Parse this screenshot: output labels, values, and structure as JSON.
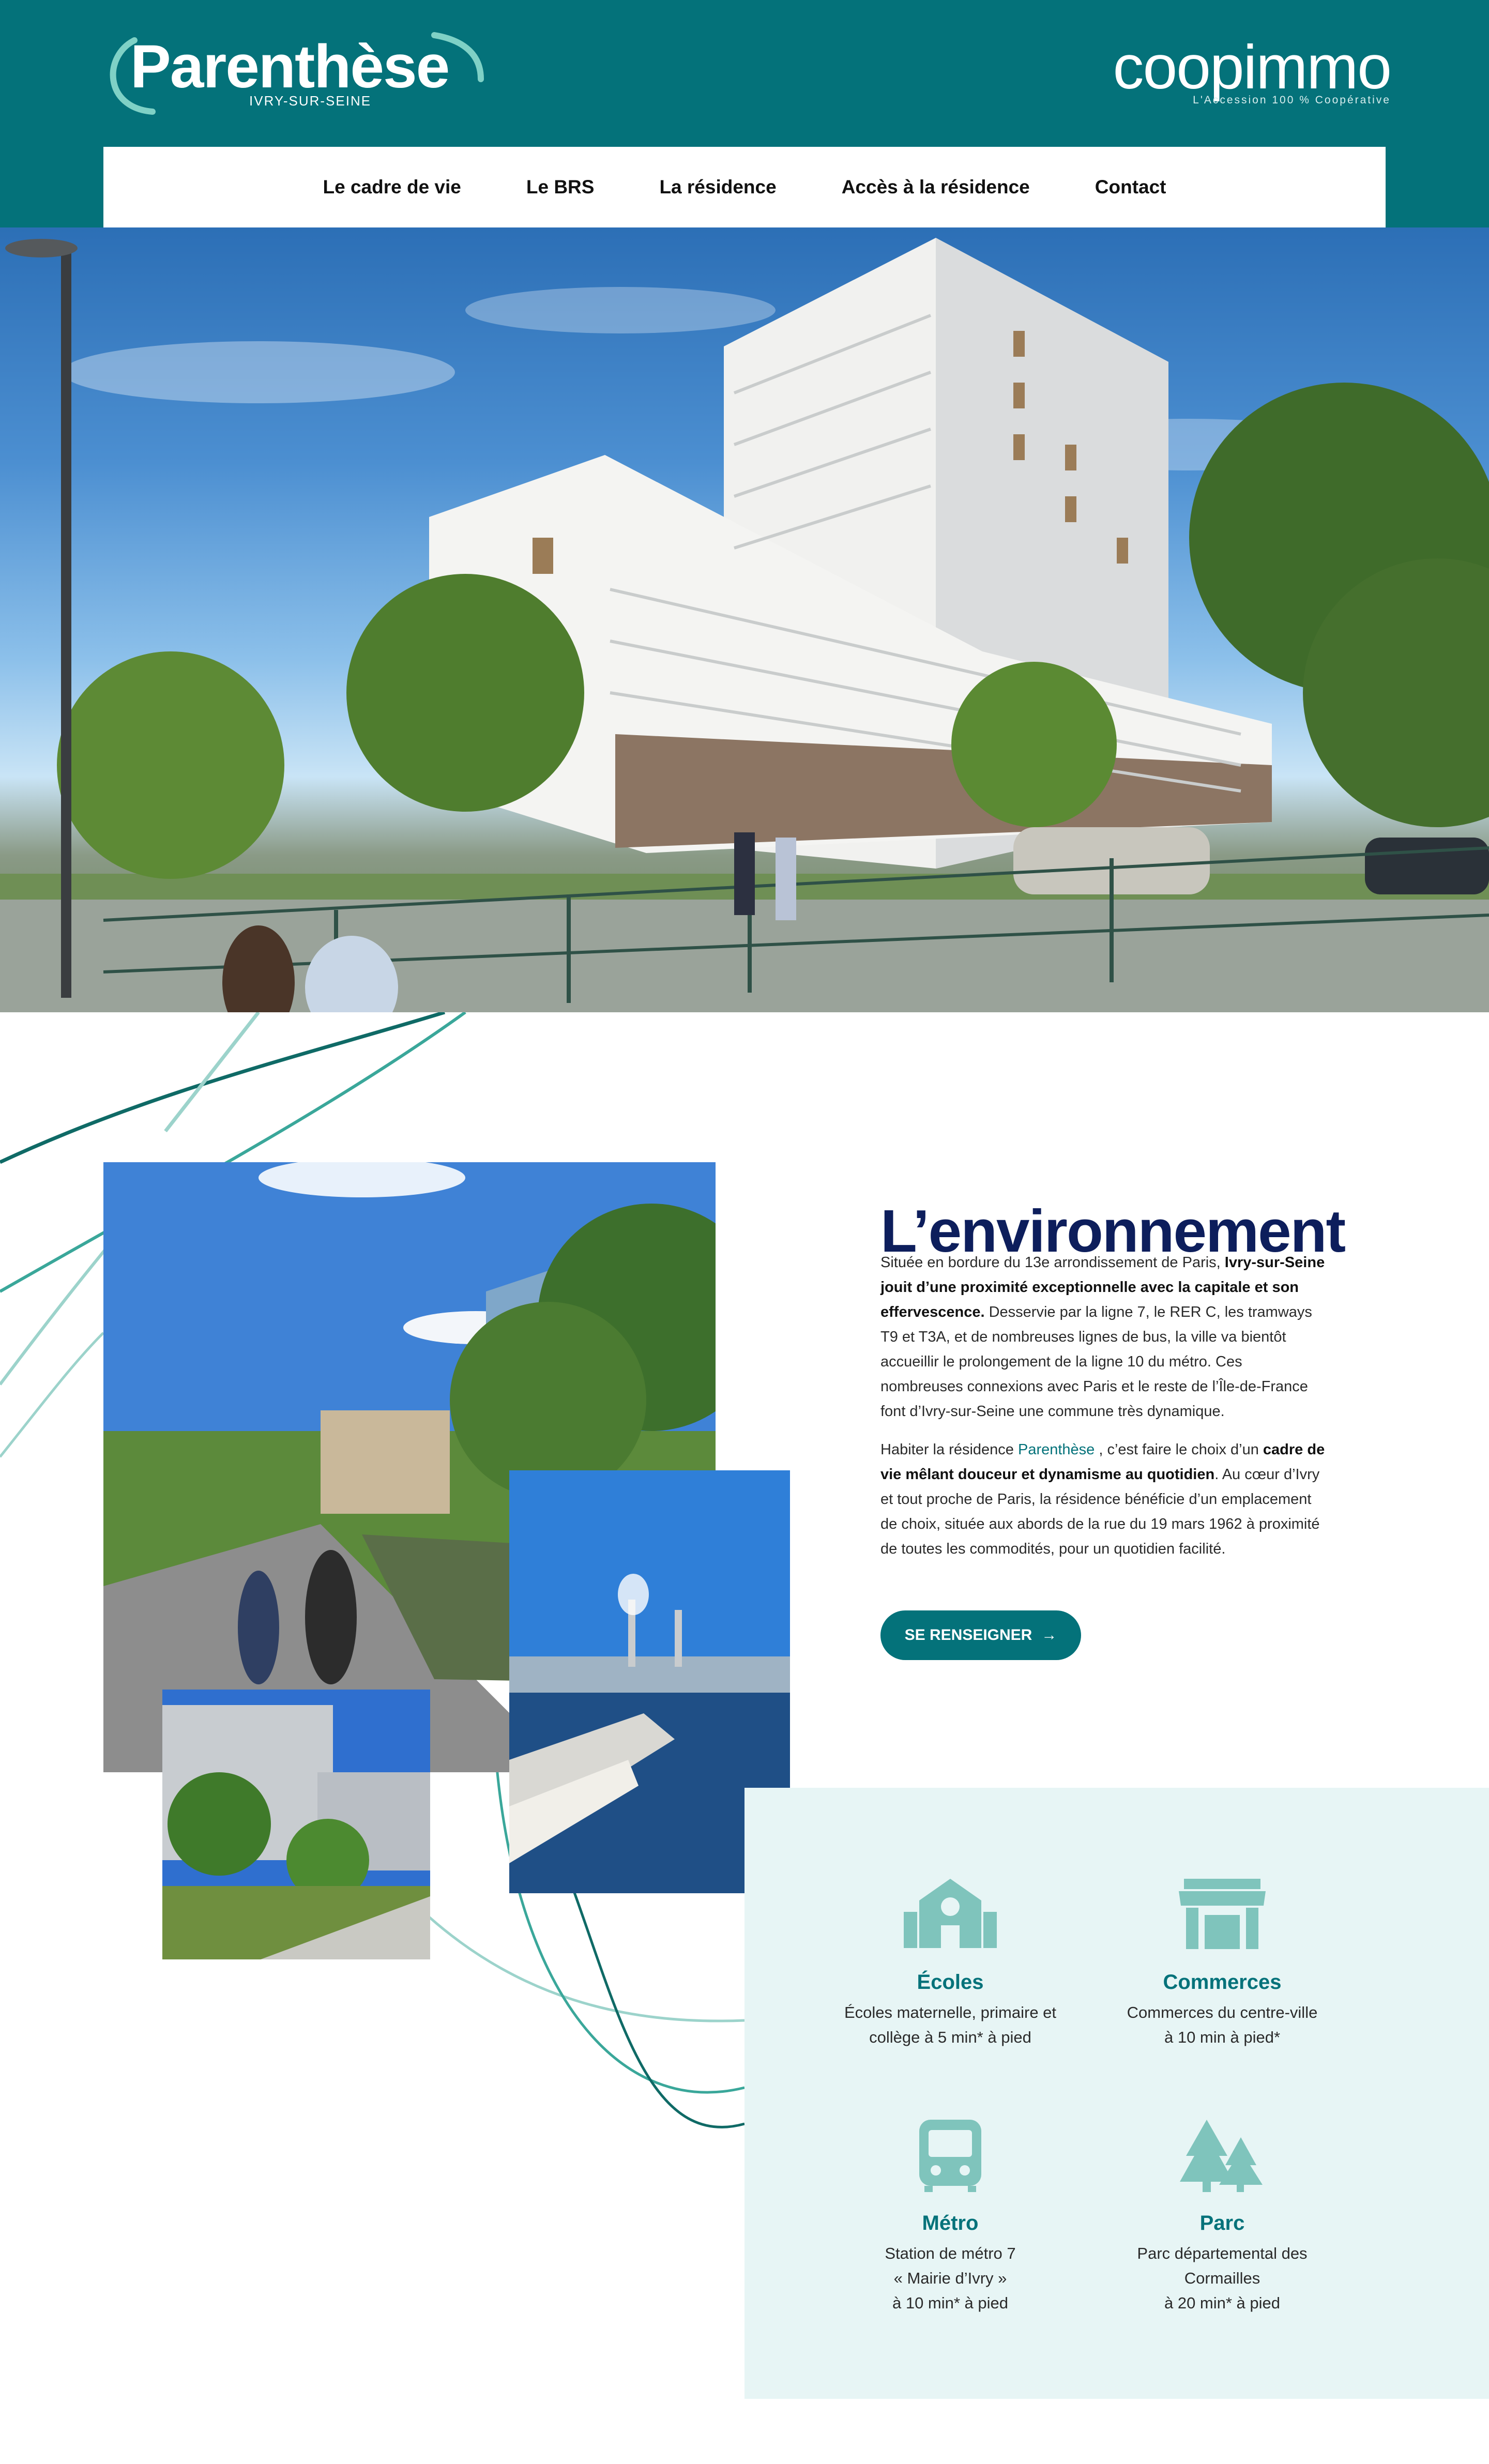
{
  "header": {
    "brand": "Parenthèse",
    "brand_sub": "IVRY-SUR-SEINE",
    "partner": "coopimmo",
    "partner_tag": "L'Accession 100 % Coopérative"
  },
  "nav": {
    "items": [
      {
        "label": "Le cadre de vie"
      },
      {
        "label": "Le BRS"
      },
      {
        "label": "La résidence"
      },
      {
        "label": "Accès à la résidence"
      },
      {
        "label": "Contact"
      }
    ]
  },
  "environment": {
    "title": "L’environnement",
    "p1": {
      "a": "Située en bordure du 13e arrondissement de Paris, ",
      "b": "Ivry-sur-Seine jouit d’une proximité exceptionnelle avec la capitale et son effervescence.",
      "c": " Desservie par la ligne 7, le RER C, les tramways T9 et T3A, et de nombreuses lignes de bus, la ville va bientôt accueillir le prolongement de la ligne 10 du métro. Ces nombreuses connexions avec Paris et le reste de l’Île-de-France font d’Ivry-sur-Seine une commune très dynamique."
    },
    "p2": {
      "a": "Habiter la résidence ",
      "b": "Parenthèse",
      "c": " , c’est faire le choix d’un ",
      "d": "cadre de vie mêlant douceur et dynamisme au quotidien",
      "e": ". Au cœur d’Ivry et tout proche de Paris, la résidence bénéficie d’un emplacement de choix, située aux abords de la rue du 19 mars 1962 à proximité de toutes les commodités, pour un quotidien facilité."
    },
    "cta": "SE RENSEIGNER",
    "cta_arrow": "→"
  },
  "amenities": [
    {
      "icon": "school-icon",
      "title": "Écoles",
      "line1": "Écoles maternelle, primaire et",
      "line2": "collège à 5 min* à pied",
      "line3": ""
    },
    {
      "icon": "shop-icon",
      "title": "Commerces",
      "line1": "Commerces du centre-ville",
      "line2": "à 10 min à pied*",
      "line3": ""
    },
    {
      "icon": "metro-icon",
      "title": "Métro",
      "line1": "Station de métro 7",
      "line2": "« Mairie d’Ivry »",
      "line3": "à 10 min* à pied"
    },
    {
      "icon": "trees-icon",
      "title": "Parc",
      "line1": "Parc départemental des",
      "line2": "Cormailles",
      "line3": "à 20 min* à pied"
    }
  ],
  "colors": {
    "teal": "#04727A",
    "navy": "#0d1e5c",
    "mint_bg": "#E7F5F5",
    "icon_mint": "#7FC4BC"
  }
}
